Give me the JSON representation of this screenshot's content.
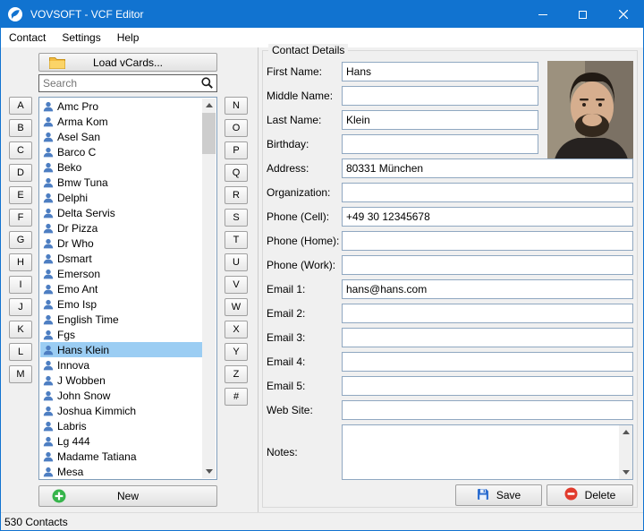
{
  "window": {
    "title": "VOVSOFT - VCF Editor",
    "status_text": "530 Contacts"
  },
  "menu": {
    "items": [
      "Contact",
      "Settings",
      "Help"
    ]
  },
  "icons": {
    "app": "vovsoft-logo",
    "load": "folder-icon",
    "search": "magnifier-icon",
    "contact": "person-icon",
    "new": "plus-circle-icon",
    "save": "floppy-icon",
    "delete": "minus-circle-icon"
  },
  "left": {
    "load_button": "Load vCards...",
    "search_placeholder": "Search",
    "new_button": "New",
    "letters_left": [
      "A",
      "B",
      "C",
      "D",
      "E",
      "F",
      "G",
      "H",
      "I",
      "J",
      "K",
      "L",
      "M"
    ],
    "letters_right": [
      "N",
      "O",
      "P",
      "Q",
      "R",
      "S",
      "T",
      "U",
      "V",
      "W",
      "X",
      "Y",
      "Z",
      "#"
    ],
    "contacts": [
      "Amc Pro",
      "Arma Kom",
      "Asel San",
      "Barco C",
      "Beko",
      "Bmw Tuna",
      "Delphi",
      "Delta Servis",
      "Dr Pizza",
      "Dr Who",
      "Dsmart",
      "Emerson",
      "Emo Ant",
      "Emo Isp",
      "English Time",
      "Fgs",
      "Hans Klein",
      "Innova",
      "J Wobben",
      "John Snow",
      "Joshua Kimmich",
      "Labris",
      "Lg 444",
      "Madame Tatiana",
      "Mesa"
    ],
    "selected_contact": "Hans Klein"
  },
  "details": {
    "group_title": "Contact Details",
    "fields": [
      {
        "key": "first-name",
        "label": "First Name:",
        "value": "Hans",
        "wide": false
      },
      {
        "key": "middle-name",
        "label": "Middle Name:",
        "value": "",
        "wide": false
      },
      {
        "key": "last-name",
        "label": "Last Name:",
        "value": "Klein",
        "wide": false
      },
      {
        "key": "birthday",
        "label": "Birthday:",
        "value": "",
        "wide": false
      },
      {
        "key": "address",
        "label": "Address:",
        "value": "80331 München",
        "wide": true
      },
      {
        "key": "organization",
        "label": "Organization:",
        "value": "",
        "wide": true
      },
      {
        "key": "phone-cell",
        "label": "Phone (Cell):",
        "value": "+49 30 12345678",
        "wide": true
      },
      {
        "key": "phone-home",
        "label": "Phone (Home):",
        "value": "",
        "wide": true
      },
      {
        "key": "phone-work",
        "label": "Phone (Work):",
        "value": "",
        "wide": true
      },
      {
        "key": "email-1",
        "label": "Email 1:",
        "value": "hans@hans.com",
        "wide": true
      },
      {
        "key": "email-2",
        "label": "Email 2:",
        "value": "",
        "wide": true
      },
      {
        "key": "email-3",
        "label": "Email 3:",
        "value": "",
        "wide": true
      },
      {
        "key": "email-4",
        "label": "Email 4:",
        "value": "",
        "wide": true
      },
      {
        "key": "email-5",
        "label": "Email 5:",
        "value": "",
        "wide": true
      },
      {
        "key": "web-site",
        "label": "Web Site:",
        "value": "",
        "wide": true
      }
    ],
    "notes_label": "Notes:",
    "notes_value": "",
    "save_button": "Save",
    "delete_button": "Delete"
  }
}
